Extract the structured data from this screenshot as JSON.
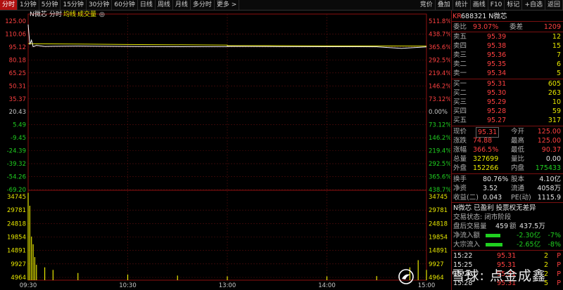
{
  "toolbar": {
    "left": [
      "分时",
      "1分钟",
      "5分钟",
      "15分钟",
      "30分钟",
      "60分钟",
      "日线",
      "周线",
      "月线",
      "多分时",
      "更多 >"
    ],
    "right": [
      "竞价",
      "叠加",
      "统计",
      "画线",
      "F10",
      "标记",
      "+自选",
      "返回"
    ]
  },
  "chart_header": {
    "name": "N微芯",
    "tabs": [
      "分时",
      "均线",
      "成交量"
    ],
    "badge": "◎"
  },
  "price_axis_left": [
    "125.00",
    "110.06",
    "95.12",
    "80.18",
    "65.25",
    "50.31",
    "35.37",
    "20.43",
    "5.49",
    "-9.45",
    "-24.39",
    "-39.32",
    "-54.26",
    "-69.20"
  ],
  "price_axis_right": [
    "511.8%",
    "438.7%",
    "365.6%",
    "292.5%",
    "219.4%",
    "146.2%",
    "73.12%",
    "0.00%",
    "73.12%",
    "146.2%",
    "219.4%",
    "292.5%",
    "365.6%",
    "438.7%"
  ],
  "volume_axis_left": [
    "34745",
    "29781",
    "24818",
    "19854",
    "14891",
    "9927",
    "4964"
  ],
  "volume_axis_right": [
    "34745",
    "29781",
    "24818",
    "19854",
    "14891",
    "9927",
    "4964"
  ],
  "time_axis": [
    "09:30",
    "10:30",
    "13:00",
    "14:00",
    "15:00"
  ],
  "chart_data": {
    "type": "line",
    "price_series": {
      "x": [
        "09:30",
        "09:31",
        "09:32",
        "09:33",
        "09:35",
        "09:40",
        "09:45",
        "10:00",
        "10:30",
        "11:00",
        "11:30",
        "13:00",
        "13:30",
        "14:00",
        "14:30",
        "14:45",
        "14:50",
        "15:00"
      ],
      "values": [
        121.0,
        98.0,
        103.0,
        95.5,
        97.0,
        95.8,
        96.0,
        96.2,
        95.8,
        95.5,
        95.6,
        95.9,
        95.6,
        95.5,
        95.4,
        93.5,
        94.2,
        95.31
      ]
    },
    "avg_series": {
      "x": [
        "09:30",
        "09:35",
        "10:00",
        "10:30",
        "11:30",
        "13:00",
        "14:00",
        "15:00"
      ],
      "values": [
        99.0,
        98.8,
        98.5,
        98.0,
        97.3,
        96.8,
        96.4,
        96.2
      ]
    },
    "volume": {
      "x": [
        "09:30",
        "09:31",
        "09:32",
        "09:33",
        "09:34",
        "09:35",
        "09:40",
        "09:45",
        "10:00",
        "10:30",
        "11:00",
        "13:00",
        "14:00",
        "14:30",
        "14:50",
        "14:55",
        "15:00"
      ],
      "values": [
        34000,
        29000,
        17000,
        14000,
        9000,
        6000,
        5000,
        4000,
        2800,
        2200,
        1800,
        1500,
        1500,
        1600,
        5000,
        7800,
        4000
      ]
    },
    "price_range": [
      -69.2,
      125.0
    ],
    "volume_range": [
      0,
      34745
    ]
  },
  "quote": {
    "title_prefix": "KR",
    "title": "688321 N微芯",
    "weibi": "委比",
    "weibi_v": "93.07%",
    "weicha": "委差",
    "weicha_v": "1209",
    "asks": [
      {
        "label": "卖五",
        "price": "95.39",
        "vol": "12"
      },
      {
        "label": "卖四",
        "price": "95.38",
        "vol": "15"
      },
      {
        "label": "卖三",
        "price": "95.36",
        "vol": "7"
      },
      {
        "label": "卖二",
        "price": "95.35",
        "vod": "",
        "vol": "6"
      },
      {
        "label": "卖一",
        "price": "95.34",
        "vol": "5"
      }
    ],
    "bids": [
      {
        "label": "买一",
        "price": "95.31",
        "vol": "605"
      },
      {
        "label": "买二",
        "price": "95.30",
        "vol": "263"
      },
      {
        "label": "买三",
        "price": "95.29",
        "vol": "10"
      },
      {
        "label": "买四",
        "price": "95.28",
        "vol": "59"
      },
      {
        "label": "买五",
        "price": "95.27",
        "vol": "317"
      }
    ],
    "stats": [
      {
        "l1": "现价",
        "v1": "95.31",
        "l2": "今开",
        "v2": "125.00"
      },
      {
        "l1": "涨跌",
        "v1": "74.88",
        "l2": "最高",
        "v2": "125.00"
      },
      {
        "l1": "涨幅",
        "v1": "366.5%",
        "l2": "最低",
        "v2": "90.37"
      },
      {
        "l1": "总量",
        "v1": "327699",
        "l2": "量比",
        "v2": "0.00"
      },
      {
        "l1": "外盘",
        "v1": "152266",
        "l2": "内盘",
        "v2": "175433"
      }
    ],
    "stats2": [
      {
        "l1": "换手",
        "v1": "80.76%",
        "l2": "股本",
        "v2": "4.10亿"
      },
      {
        "l1": "净资",
        "v1": "3.52",
        "l2": "流通",
        "v2": "4058万"
      },
      {
        "l1": "收益(二)",
        "v1": "0.043",
        "l2": "PE(动)",
        "v2": "1115.9"
      }
    ],
    "info_line1": "N微芯 已盈利 投票权无差异",
    "info_line2": "交易状态: 闭市阶段",
    "info_line3_a": "盘后交易量",
    "info_line3_b": "459",
    "info_line3_c": "额",
    "info_line3_d": "437.5万",
    "flow": [
      {
        "label": "净流入额",
        "value": "-2.30亿",
        "pct": "-7%",
        "fill": 0.7
      },
      {
        "label": "大宗流入",
        "value": "-2.65亿",
        "pct": "-8%",
        "fill": 0.8
      }
    ],
    "ticks": [
      {
        "time": "15:22",
        "price": "95.31",
        "vol": "2",
        "flag": "P"
      },
      {
        "time": "15:25",
        "price": "95.31",
        "vol": "2",
        "flag": "P"
      },
      {
        "time": "15:26",
        "price": "95.31",
        "vol": "2",
        "flag": "P"
      },
      {
        "time": "15:28",
        "price": "95.31",
        "vol": "5",
        "flag": "P"
      }
    ]
  },
  "watermark": "雪球: 点金成鑫"
}
